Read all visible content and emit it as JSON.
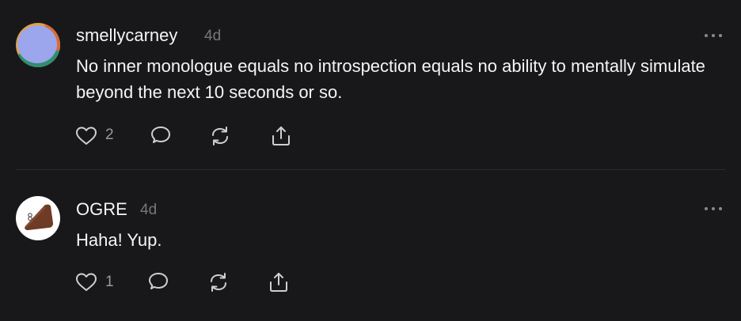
{
  "posts": [
    {
      "username": "smellycarney",
      "time": "4d",
      "text": "No inner monologue equals no introspection equals no ability to mentally simulate beyond the next 10 seconds or so.",
      "likes": "2"
    },
    {
      "username": "OGRE",
      "time": "4d",
      "text": "Haha! Yup.",
      "likes": "1"
    }
  ],
  "icons": {
    "more": "more-dots-icon",
    "like": "heart-icon",
    "reply": "speech-bubble-icon",
    "repost": "repost-icon",
    "share": "share-icon"
  },
  "colors": {
    "background": "#18181a",
    "text": "#f3f5f7",
    "muted": "#777777",
    "icon": "#cfcfcf"
  }
}
